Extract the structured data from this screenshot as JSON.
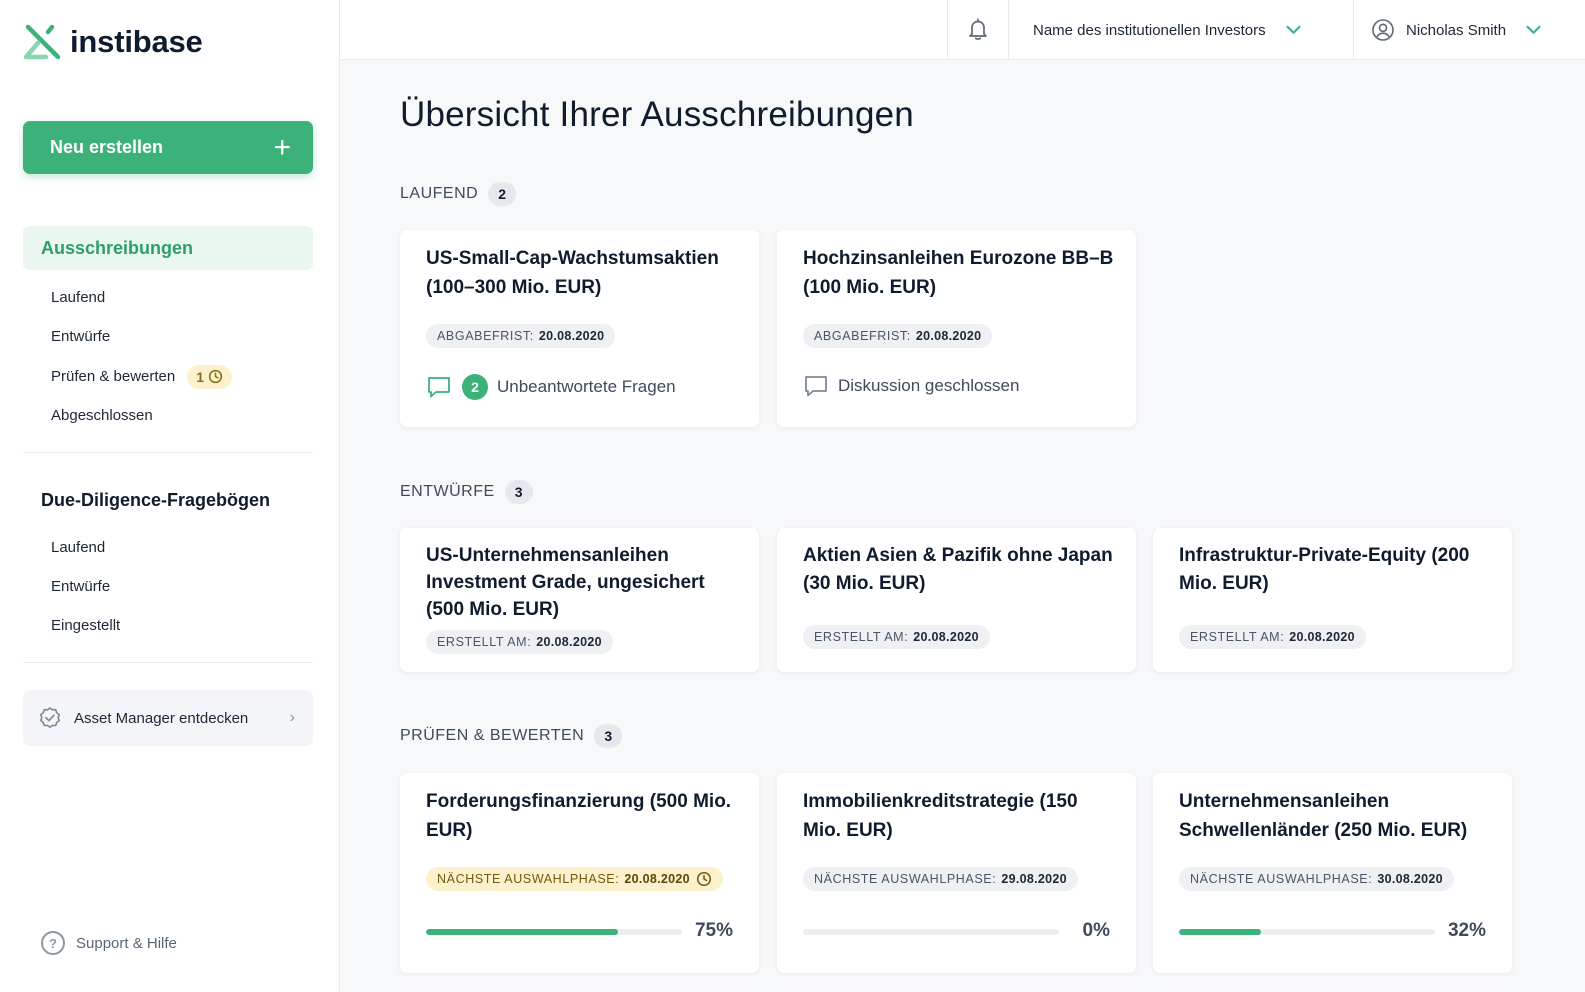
{
  "brand": {
    "name": "instibase",
    "accent": "#3db17a"
  },
  "sidebar": {
    "new_button": {
      "label": "Neu erstellen",
      "icon": "plus-icon"
    },
    "tenders": {
      "title": "Ausschreibungen",
      "items": [
        "Laufend",
        "Entwürfe",
        "Prüfen & bewerten",
        "Abgeschlossen"
      ],
      "review_badge": "1"
    },
    "dd": {
      "title": "Due-Diligence-Fragebögen",
      "items": [
        "Laufend",
        "Entwürfe",
        "Eingestellt"
      ]
    },
    "discover": "Asset Manager entdecken",
    "support": "Support & Hilfe"
  },
  "topbar": {
    "investor": "Name des institutionellen Investors",
    "user": "Nicholas Smith"
  },
  "main": {
    "title": "Übersicht Ihrer Ausschreibungen",
    "running": {
      "label": "LAUFEND",
      "count": "2",
      "cards": [
        {
          "title": "US-Small-Cap-Wachstumsaktien (100–300 Mio. EUR)",
          "tag_label": "ABGABEFRIST:",
          "tag_value": "20.08.2020",
          "badge": "2",
          "comment": "Unbeantwortete Fragen"
        },
        {
          "title": "Hochzinsanleihen Eurozone BB–B (100 Mio. EUR)",
          "tag_label": "ABGABEFRIST:",
          "tag_value": "20.08.2020",
          "comment": "Diskussion geschlossen"
        }
      ]
    },
    "drafts": {
      "label": "ENTWÜRFE",
      "count": "3",
      "cards": [
        {
          "title": "US-Unternehmensanleihen Investment Grade, ungesichert (500 Mio. EUR)",
          "tag_label": "ERSTELLT AM:",
          "tag_value": "20.08.2020"
        },
        {
          "title": "Aktien Asien & Pazifik ohne Japan (30 Mio. EUR)",
          "tag_label": "ERSTELLT AM:",
          "tag_value": "20.08.2020"
        },
        {
          "title": "Infrastruktur-Private-Equity (200 Mio. EUR)",
          "tag_label": "ERSTELLT AM:",
          "tag_value": "20.08.2020"
        }
      ]
    },
    "review": {
      "label": "PRÜFEN & BEWERTEN",
      "count": "3",
      "cards": [
        {
          "title": "Forderungsfinanzierung (500 Mio. EUR)",
          "tag_label": "NÄCHSTE AUSWAHLPHASE:",
          "tag_value": "20.08.2020",
          "progress": 75,
          "pct": "75%"
        },
        {
          "title": "Immobilienkreditstrategie (150 Mio. EUR)",
          "tag_label": "NÄCHSTE AUSWAHLPHASE:",
          "tag_value": "29.08.2020",
          "progress": 0,
          "pct": "0%"
        },
        {
          "title": "Unternehmensanleihen Schwellenländer (250 Mio. EUR)",
          "tag_label": "NÄCHSTE AUSWAHLPHASE:",
          "tag_value": "30.08.2020",
          "progress": 32,
          "pct": "32%"
        }
      ]
    }
  }
}
